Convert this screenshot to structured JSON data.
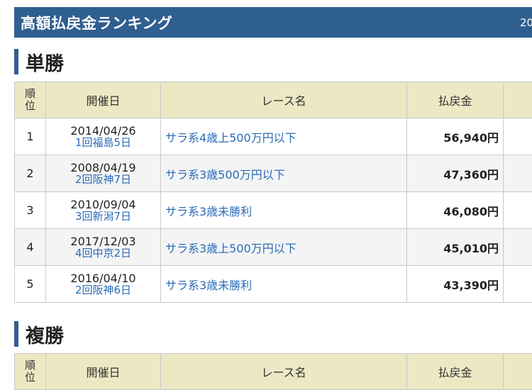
{
  "header": {
    "title": "高額払戻金ランキング",
    "year": "20"
  },
  "columns": {
    "pos": [
      "順",
      "位"
    ],
    "date": "開催日",
    "race": "レース名",
    "payout": "払戻金"
  },
  "sections": [
    {
      "title": "単勝",
      "rows": [
        {
          "rank": "1",
          "date": "2014/04/26",
          "meeting": "1回福島5日",
          "race": "サラ系4歳上500万円以下",
          "payout": "56,940円"
        },
        {
          "rank": "2",
          "date": "2008/04/19",
          "meeting": "2回阪神7日",
          "race": "サラ系3歳500万円以下",
          "payout": "47,360円"
        },
        {
          "rank": "3",
          "date": "2010/09/04",
          "meeting": "3回新潟7日",
          "race": "サラ系3歳未勝利",
          "payout": "46,080円"
        },
        {
          "rank": "4",
          "date": "2017/12/03",
          "meeting": "4回中京2日",
          "race": "サラ系3歳上500万円以下",
          "payout": "45,010円"
        },
        {
          "rank": "5",
          "date": "2016/04/10",
          "meeting": "2回阪神6日",
          "race": "サラ系3歳未勝利",
          "payout": "43,390円"
        }
      ]
    },
    {
      "title": "複勝",
      "rows": []
    }
  ]
}
